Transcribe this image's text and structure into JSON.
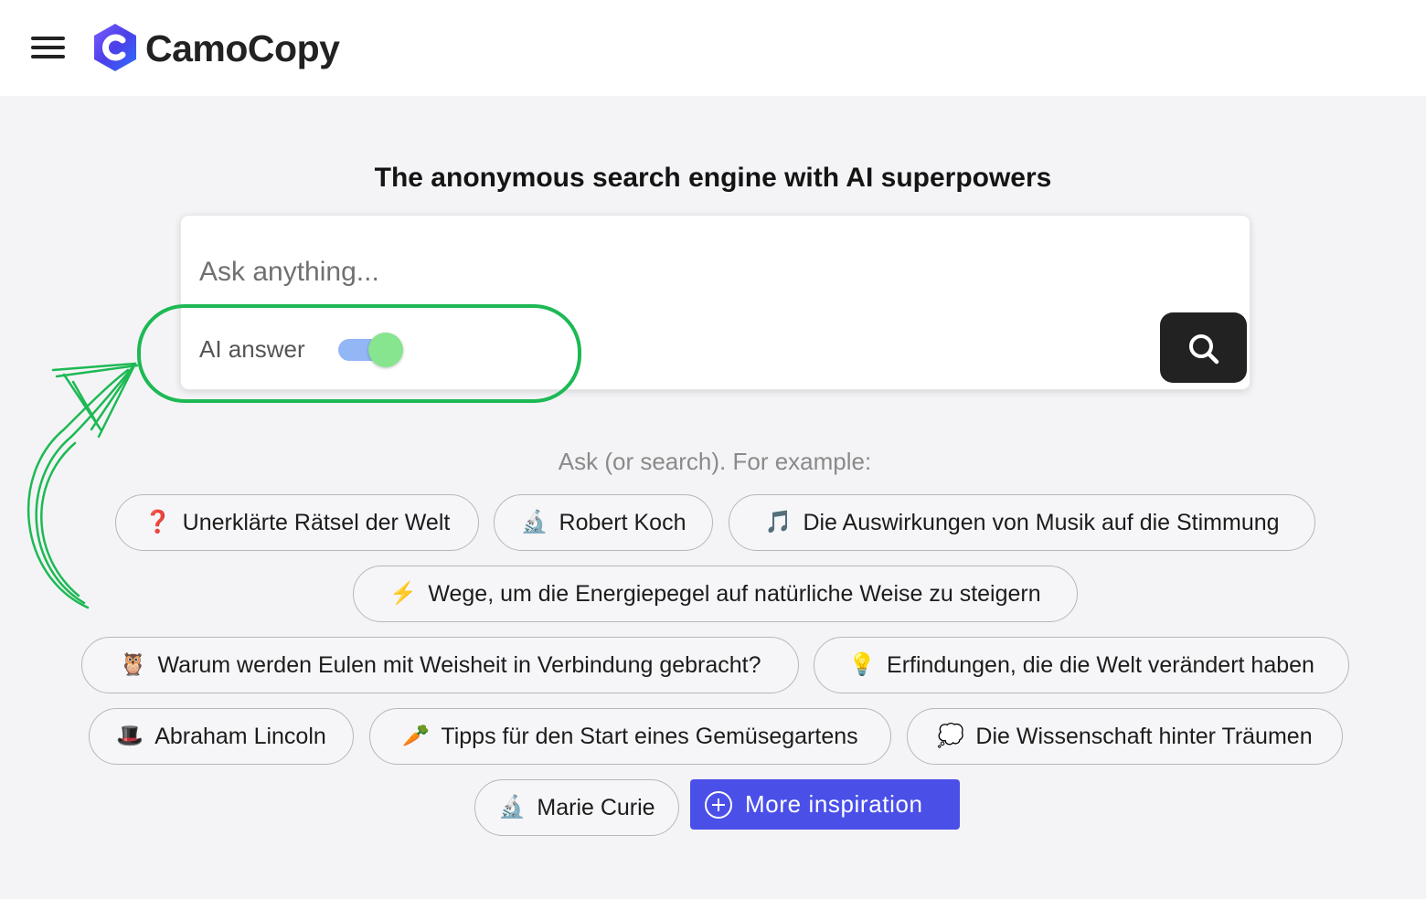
{
  "header": {
    "brand_name": "CamoCopy",
    "brand_color": "#5b3ff5"
  },
  "main": {
    "tagline": "The anonymous search engine with AI superpowers",
    "search": {
      "placeholder": "Ask anything...",
      "value": "",
      "ai_answer_label": "AI answer",
      "ai_answer_enabled": true
    },
    "examples_label": "Ask (or search). For example:",
    "examples": [
      {
        "icon": "question-mark",
        "emoji": "❓",
        "label": "Unerklärte Rätsel der Welt"
      },
      {
        "icon": "microscope",
        "emoji": "🔬",
        "label": "Robert Koch"
      },
      {
        "icon": "music-note",
        "emoji": "🎵",
        "label": "Die Auswirkungen von Musik auf die Stimmung"
      },
      {
        "icon": "lightning",
        "emoji": "⚡",
        "label": "Wege, um die Energiepegel auf natürliche Weise zu steigern"
      },
      {
        "icon": "owl",
        "emoji": "🦉",
        "label": "Warum werden Eulen mit Weisheit in Verbindung gebracht?"
      },
      {
        "icon": "light-bulb",
        "emoji": "💡",
        "label": "Erfindungen, die die Welt verändert haben"
      },
      {
        "icon": "top-hat",
        "emoji": "🎩",
        "label": "Abraham Lincoln"
      },
      {
        "icon": "carrot",
        "emoji": "🥕",
        "label": "Tipps für den Start eines Gemüsegartens"
      },
      {
        "icon": "thought-bubble",
        "emoji": "💭",
        "label": "Die Wissenschaft hinter Träumen"
      },
      {
        "icon": "microscope",
        "emoji": "🔬",
        "label": "Marie Curie"
      }
    ],
    "more_button_label": "More inspiration",
    "more_button_color": "#4a4fe8"
  },
  "annotation": {
    "color": "#1db954"
  }
}
